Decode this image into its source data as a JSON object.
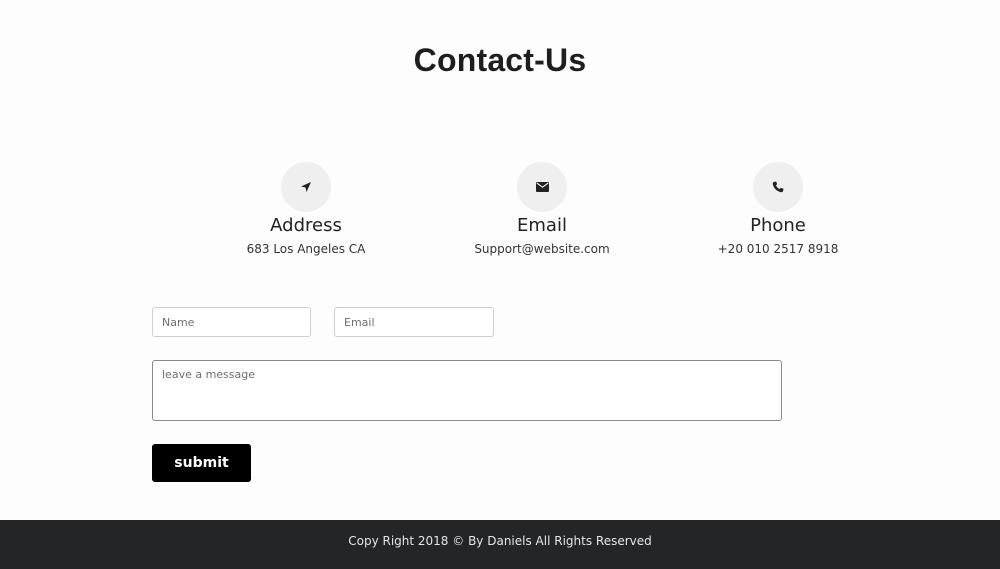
{
  "page": {
    "title": "Contact-Us"
  },
  "info": [
    {
      "icon": "location-arrow-icon",
      "heading": "Address",
      "text": "683 Los Angeles CA"
    },
    {
      "icon": "envelope-icon",
      "heading": "Email",
      "text": "Support@website.com"
    },
    {
      "icon": "phone-icon",
      "heading": "Phone",
      "text": "+20 010 2517 8918"
    }
  ],
  "form": {
    "name_placeholder": "Name",
    "email_placeholder": "Email",
    "message_placeholder": "leave a message",
    "submit_label": "submit"
  },
  "footer": {
    "text": "Copy Right 2018 © By Daniels All Rights Reserved"
  },
  "colors": {
    "icon_bg": "#efefef",
    "button_bg": "#000000",
    "footer_bg": "#232526"
  }
}
